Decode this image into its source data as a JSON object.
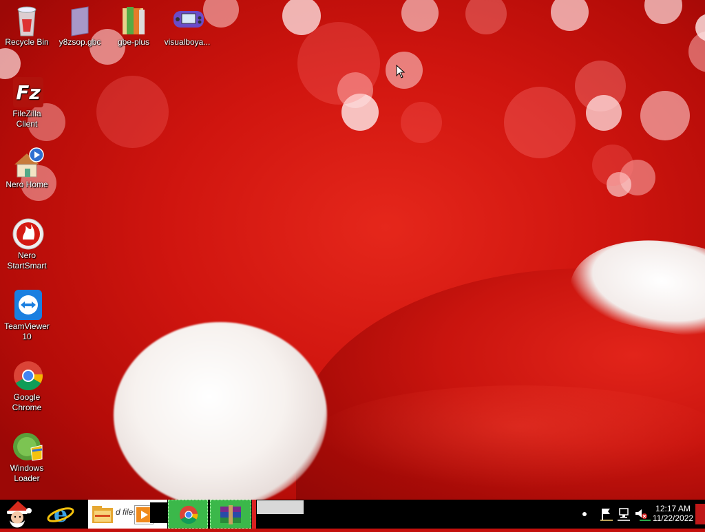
{
  "desktop": {
    "icons": [
      {
        "label": "Recycle Bin",
        "icon": "recycle-bin-icon"
      },
      {
        "label": "y8zsop.gbc",
        "icon": "gbc-file-icon"
      },
      {
        "label": "gbe-plus",
        "icon": "folder-icon"
      },
      {
        "label": "visualboya...",
        "icon": "gameboy-advance-icon"
      },
      {
        "label": "FileZilla Client",
        "icon": "filezilla-icon"
      },
      {
        "label": "Nero Home",
        "icon": "nero-home-icon"
      },
      {
        "label": "Nero StartSmart",
        "icon": "nero-startsmart-icon"
      },
      {
        "label": "TeamViewer 10",
        "icon": "teamviewer-icon"
      },
      {
        "label": "Google Chrome",
        "icon": "chrome-icon"
      },
      {
        "label": "Windows Loader",
        "icon": "windows-loader-icon"
      }
    ],
    "wallpaper": "christmas-santa-hat",
    "accent_red": "#c4100d"
  },
  "taskbar": {
    "start_icon": "santa-start-icon",
    "pinned": [
      {
        "name": "internet-explorer-icon"
      },
      {
        "name": "file-explorer-icon",
        "partial_text": "d files"
      },
      {
        "name": "chrome-icon"
      },
      {
        "name": "winrar-icon"
      }
    ],
    "clock": {
      "time": "12:17 AM",
      "date": "11/22/2022"
    }
  }
}
